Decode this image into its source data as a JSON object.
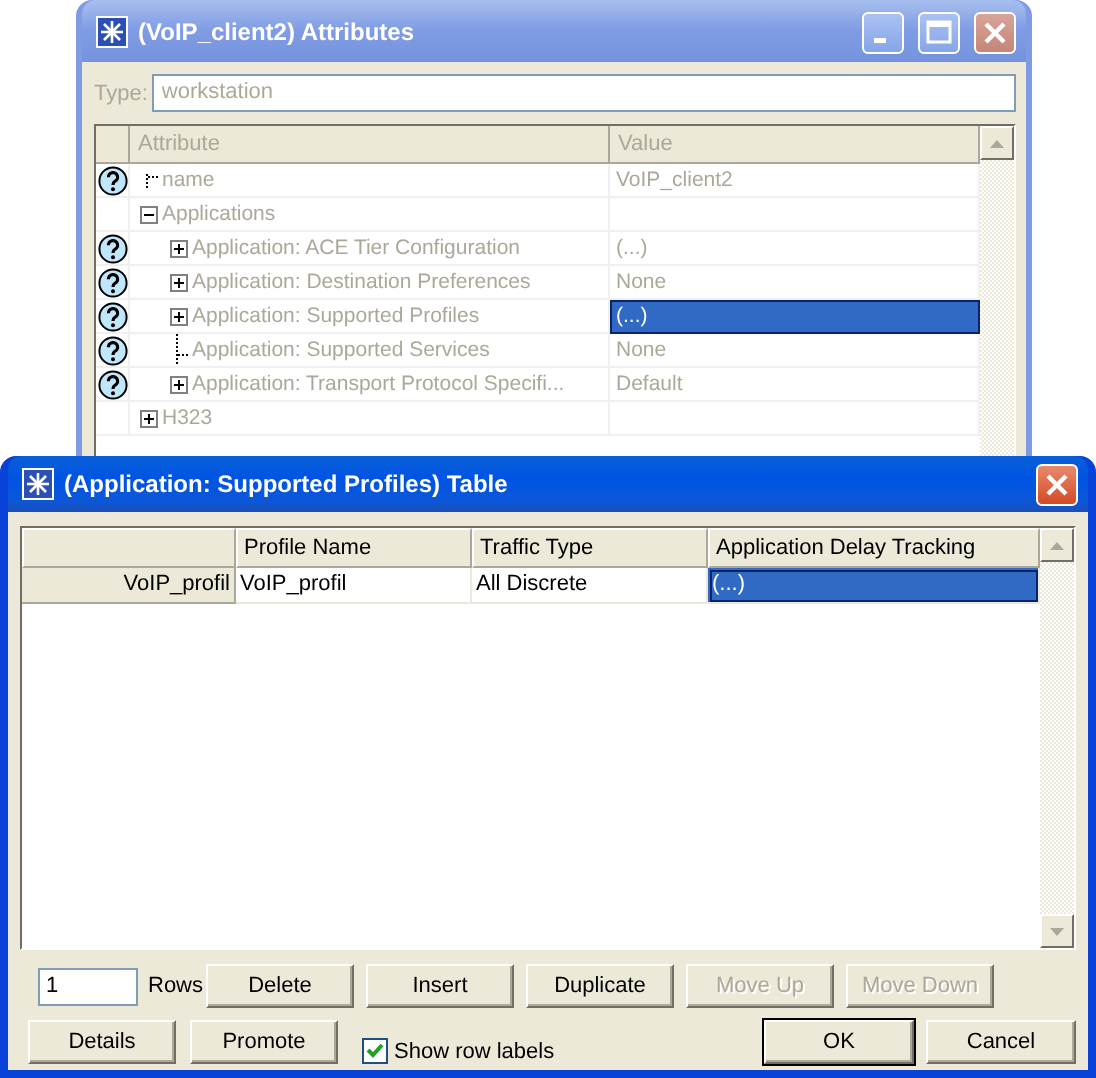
{
  "attributes_window": {
    "title": "(VoIP_client2) Attributes",
    "active": false,
    "title_buttons": [
      {
        "kind": "minimize"
      },
      {
        "kind": "maximize"
      },
      {
        "kind": "close"
      }
    ],
    "type_label": "Type:",
    "type_value": "workstation",
    "columns": [
      "Attribute",
      "Value"
    ],
    "rows": [
      {
        "label": "name",
        "value": "VoIP_client2",
        "help": true,
        "selected": false
      },
      {
        "label": "Applications",
        "help": false,
        "expanded": true,
        "selected": false,
        "children": [
          {
            "label": "Application: ACE Tier Configuration",
            "value": "(...)",
            "help": true,
            "expanded": false,
            "selected": false
          },
          {
            "label": "Application: Destination Preferences",
            "value": "None",
            "help": true,
            "expanded": false,
            "selected": false
          },
          {
            "label": "Application: Supported Profiles",
            "value": "(...)",
            "help": true,
            "expanded": false,
            "selected": true
          },
          {
            "label": "Application: Supported Services",
            "value": "None",
            "help": true,
            "selected": false
          },
          {
            "label": "Application: Transport Protocol Specifi...",
            "value": "Default",
            "help": true,
            "expanded": false,
            "selected": false
          }
        ]
      },
      {
        "label": "H323",
        "help": false,
        "expanded": false,
        "selected": false
      }
    ]
  },
  "table_window": {
    "title": "(Application: Supported Profiles) Table",
    "active": true,
    "title_buttons": [
      {
        "kind": "close"
      }
    ],
    "columns": [
      "Profile Name",
      "Traffic Type",
      "Application Delay Tracking"
    ],
    "rows": [
      {
        "label": "VoIP_profil",
        "cells": [
          {
            "text": "VoIP_profil",
            "selected": false
          },
          {
            "text": "All Discrete",
            "selected": false
          },
          {
            "text": "(...)",
            "selected": true
          }
        ]
      }
    ],
    "rows_value": "1",
    "rows_label": "Rows",
    "edit_buttons": [
      {
        "label": "Delete",
        "disabled": false
      },
      {
        "label": "Insert",
        "disabled": false
      },
      {
        "label": "Duplicate",
        "disabled": false
      },
      {
        "label": "Move Up",
        "disabled": true
      },
      {
        "label": "Move Down",
        "disabled": true
      }
    ],
    "left_buttons": [
      {
        "label": "Details",
        "disabled": false
      },
      {
        "label": "Promote",
        "disabled": false
      }
    ],
    "checkbox": {
      "label": "Show row labels",
      "checked": true
    },
    "dialog_buttons": [
      {
        "label": "OK",
        "default": true
      },
      {
        "label": "Cancel",
        "default": false
      }
    ]
  }
}
